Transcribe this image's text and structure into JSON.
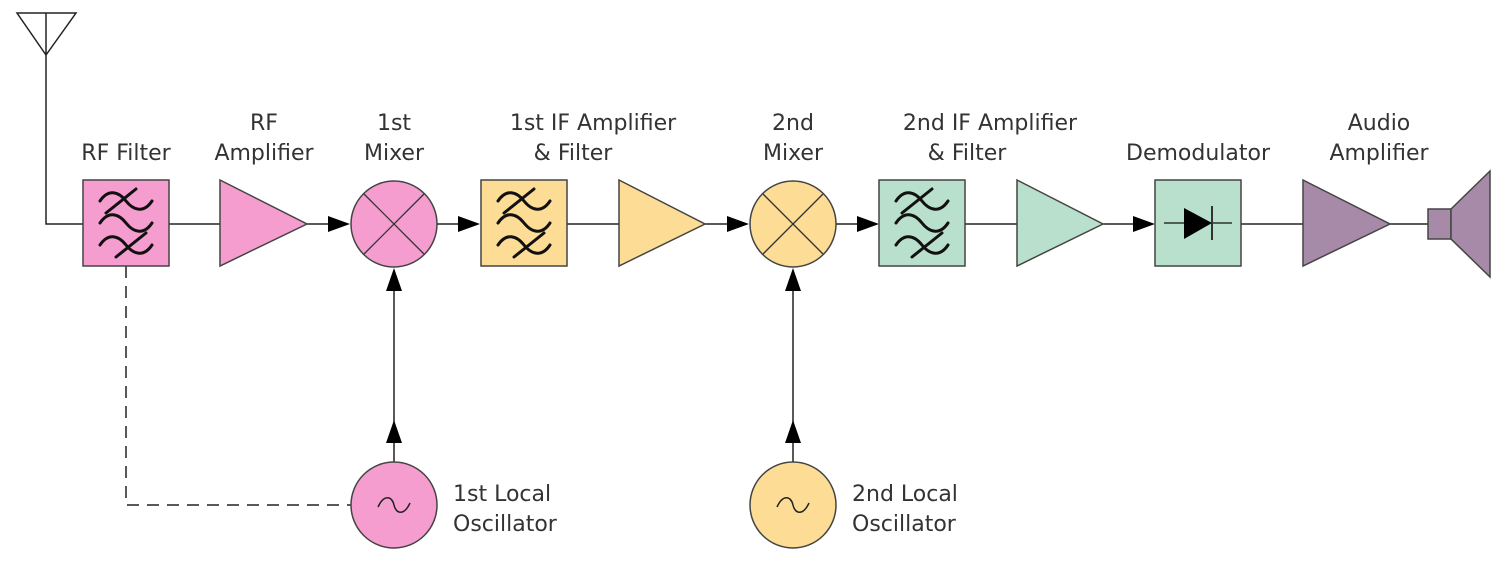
{
  "colors": {
    "rf_stage": "#F59DCE",
    "if1_stage": "#FDDC96",
    "if2_stage": "#B9E0CC",
    "audio_stage": "#A78AA8",
    "line": "#222222"
  },
  "blocks": {
    "rf_filter": {
      "label": [
        "RF Filter"
      ],
      "icon": "bandpass-filter-icon"
    },
    "rf_amplifier": {
      "label": [
        "RF",
        "Amplifier"
      ],
      "icon": "amplifier-icon"
    },
    "mixer1": {
      "label": [
        "1st",
        "Mixer"
      ],
      "icon": "mixer-icon"
    },
    "if1": {
      "label": [
        "1st IF Amplifier",
        "& Filter"
      ],
      "icon": "bandpass-filter-icon"
    },
    "mixer2": {
      "label": [
        "2nd",
        "Mixer"
      ],
      "icon": "mixer-icon"
    },
    "if2": {
      "label": [
        "2nd IF Amplifier",
        "& Filter"
      ],
      "icon": "bandpass-filter-icon"
    },
    "demodulator": {
      "label": [
        "Demodulator"
      ],
      "icon": "diode-icon"
    },
    "audio_amplifier": {
      "label": [
        "Audio",
        "Amplifier"
      ],
      "icon": "amplifier-icon"
    },
    "speaker": {
      "icon": "speaker-icon"
    },
    "antenna": {
      "icon": "antenna-icon"
    },
    "lo1": {
      "label": [
        "1st Local",
        "Oscillator"
      ],
      "icon": "oscillator-icon"
    },
    "lo2": {
      "label": [
        "2nd Local",
        "Oscillator"
      ],
      "icon": "oscillator-icon"
    }
  }
}
